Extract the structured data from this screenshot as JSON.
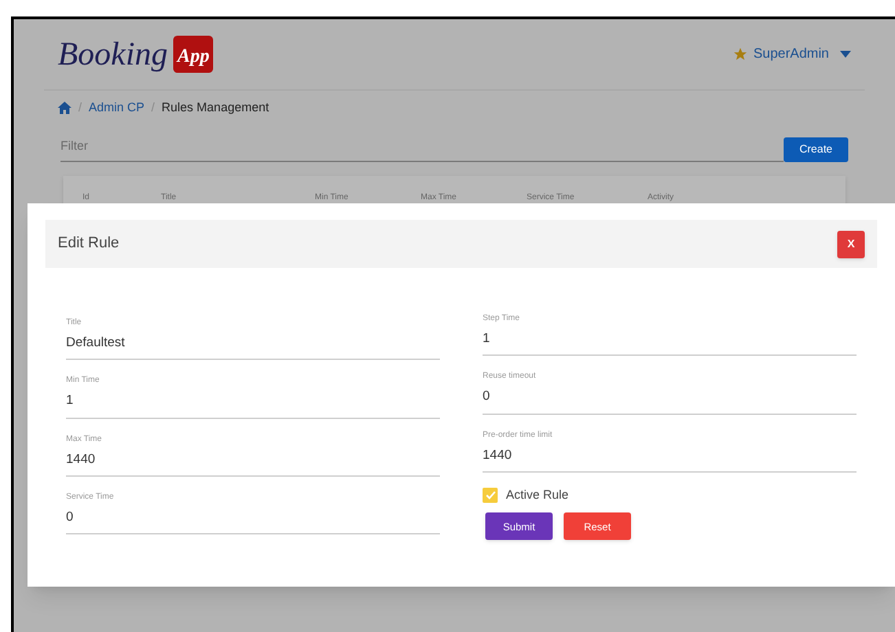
{
  "header": {
    "brand": "Booking",
    "logo_text": "App",
    "user": "SuperAdmin"
  },
  "breadcrumb": [
    {
      "separator": "/",
      "label": "Admin CP",
      "current": false
    },
    {
      "separator": "/",
      "label": "Rules Management",
      "current": true
    }
  ],
  "filter": {
    "placeholder": "Filter"
  },
  "create_button": "Create",
  "table": {
    "columns": [
      "Id",
      "Title",
      "Min Time",
      "Max Time",
      "Service Time",
      "Activity"
    ]
  },
  "modal": {
    "title": "Edit Rule",
    "close": "X",
    "left_fields": [
      {
        "label": "Title",
        "value": "Defaultest"
      },
      {
        "label": "Min Time",
        "value": "1"
      },
      {
        "label": "Max Time",
        "value": "1440"
      },
      {
        "label": "Service Time",
        "value": "0"
      }
    ],
    "right_fields": [
      {
        "label": "Step Time",
        "value": "1"
      },
      {
        "label": "Reuse timeout",
        "value": "0"
      },
      {
        "label": "Pre-order time limit",
        "value": "1440"
      }
    ],
    "active_rule": {
      "label": "Active Rule",
      "checked": true
    },
    "buttons": [
      {
        "label": "Submit",
        "kind": "primary"
      },
      {
        "label": "Reset",
        "kind": "danger"
      }
    ]
  }
}
